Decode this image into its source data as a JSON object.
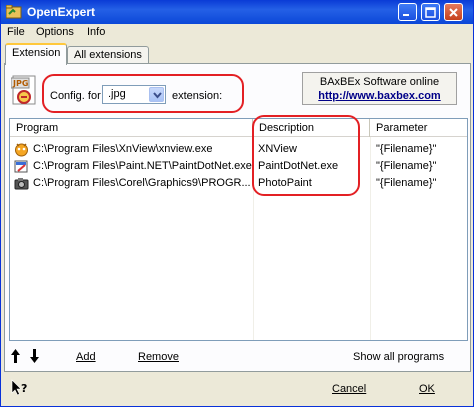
{
  "title": "OpenExpert",
  "menu": [
    "File",
    "Options",
    "Info"
  ],
  "tabs": [
    "Extension",
    "All extensions"
  ],
  "config": {
    "prefix": "Config. for",
    "selected": ".jpg",
    "suffix": "extension:"
  },
  "info": {
    "company": "BAxBEx Software online",
    "url": "http://www.baxbex.com"
  },
  "columns": [
    "Program",
    "Description",
    "Parameter"
  ],
  "rows": [
    {
      "icon": "xnview-icon",
      "program": "C:\\Program Files\\XnView\\xnview.exe",
      "description": "XNView",
      "parameter": "\"{Filename}\""
    },
    {
      "icon": "paintdotnet-icon",
      "program": "C:\\Program Files\\Paint.NET\\PaintDotNet.exe",
      "description": "PaintDotNet.exe",
      "parameter": "\"{Filename}\""
    },
    {
      "icon": "camera-icon",
      "program": "C:\\Program Files\\Corel\\Graphics9\\PROGR...",
      "description": "PhotoPaint",
      "parameter": "\"{Filename}\""
    }
  ],
  "buttons": {
    "add": "Add",
    "remove": "Remove",
    "show_all": "Show all programs",
    "cancel": "Cancel",
    "ok": "OK"
  },
  "colors": {
    "titlebar": "#0a3bd6",
    "annotation": "#e32024",
    "link": "#000088"
  }
}
